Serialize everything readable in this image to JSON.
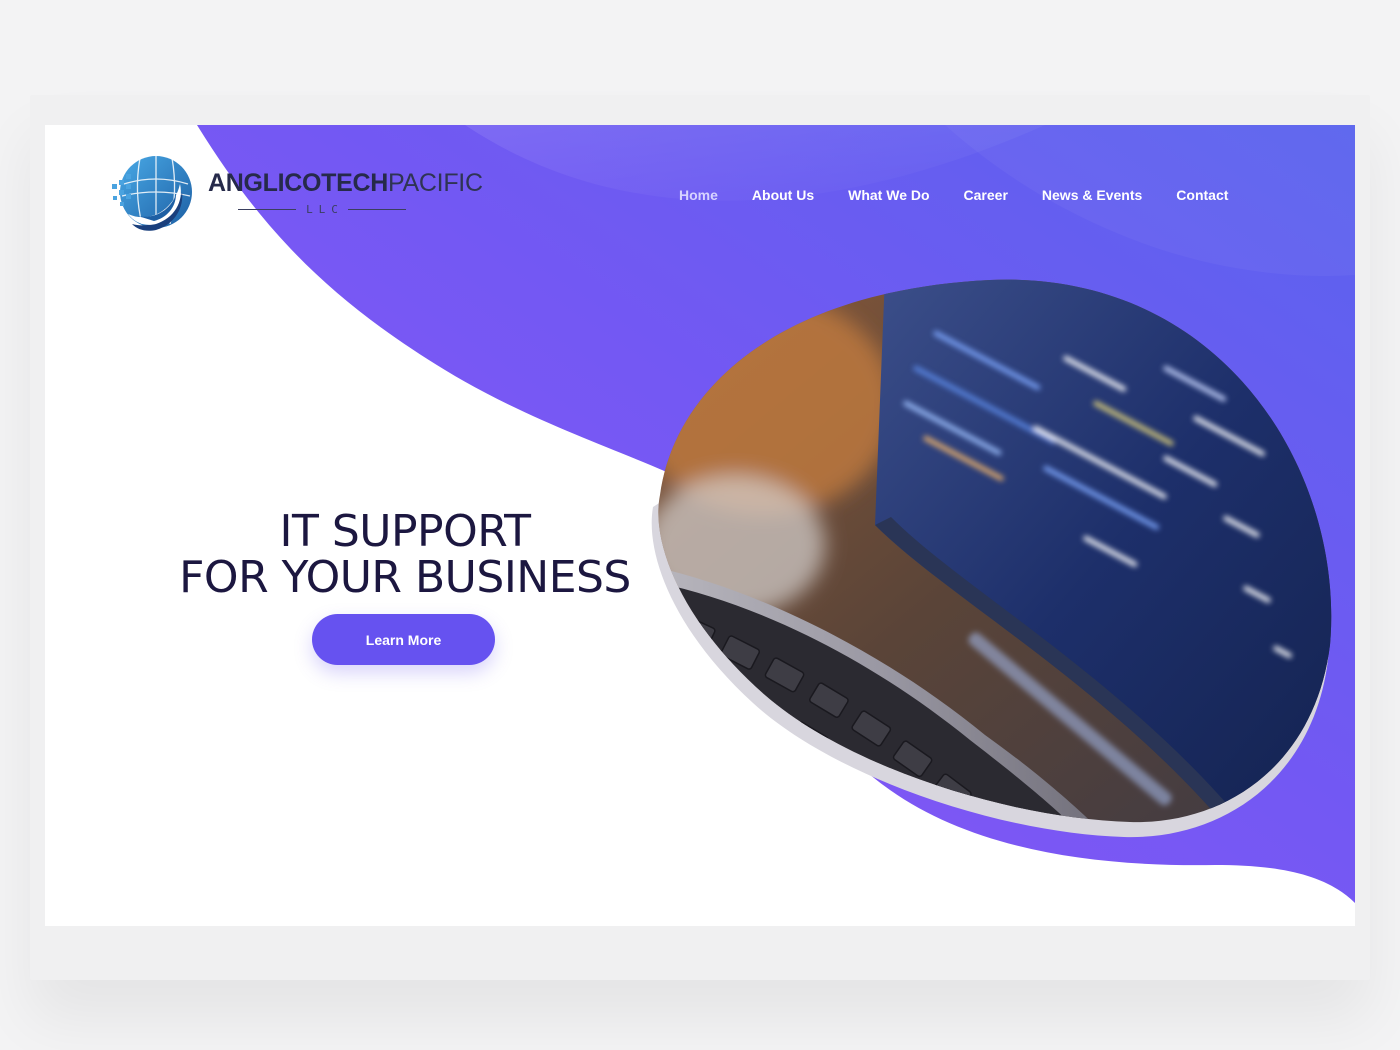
{
  "brand": {
    "name_strong": "ANGLICOTECH",
    "name_light": "PACIFIC",
    "suffix": "LLC"
  },
  "nav": {
    "items": [
      {
        "label": "Home",
        "active": true
      },
      {
        "label": "About Us",
        "active": false
      },
      {
        "label": "What We Do",
        "active": false
      },
      {
        "label": "Career",
        "active": false
      },
      {
        "label": "News & Events",
        "active": false
      },
      {
        "label": "Contact",
        "active": false
      }
    ]
  },
  "hero": {
    "title_line1": "IT SUPPORT",
    "title_line2": "FOR YOUR BUSINESS",
    "cta_label": "Learn More"
  },
  "colors": {
    "accent": "#6652f0",
    "purple_light": "#8a5cf6",
    "purple_blue": "#5a5ff0",
    "title": "#1c1740",
    "logo_blue": "#1f5a9e",
    "logo_light": "#4aa3e0"
  },
  "icons": {
    "logo": "globe-wave-icon",
    "hero_image": "laptop-code-photo"
  }
}
